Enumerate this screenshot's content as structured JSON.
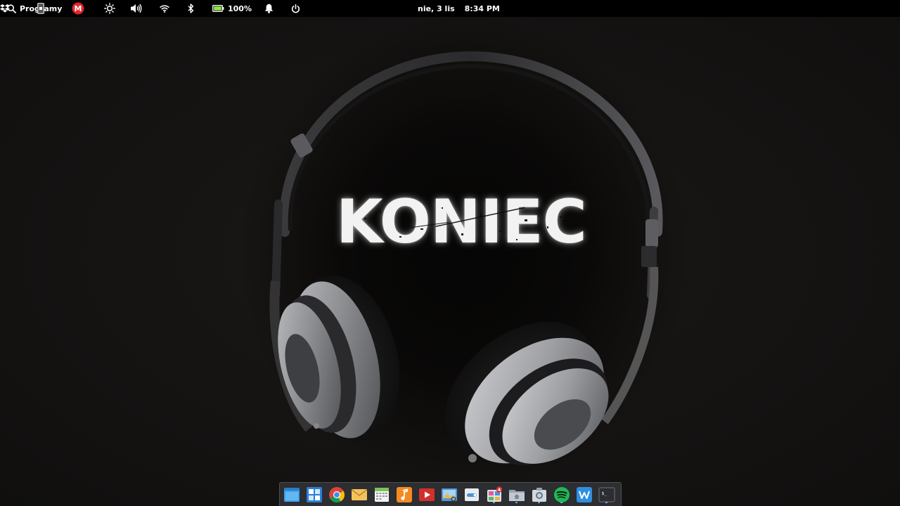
{
  "top_panel": {
    "apps_menu": {
      "label": "Programy",
      "icon": "search-icon"
    },
    "clock": {
      "date": "nie, 3 lis",
      "time": "8:34 PM"
    },
    "indicators": [
      {
        "name": "dropbox-icon"
      },
      {
        "name": "phone-icon"
      },
      {
        "name": "mega-icon",
        "label": "M",
        "color": "#e1242b"
      },
      {
        "name": "brightness-icon"
      },
      {
        "name": "volume-icon"
      },
      {
        "name": "wifi-icon"
      },
      {
        "name": "bluetooth-icon"
      },
      {
        "name": "battery-icon",
        "label": "100%",
        "level": 1.0,
        "color": "#8ee83f"
      },
      {
        "name": "notifications-icon"
      },
      {
        "name": "power-icon"
      }
    ]
  },
  "wallpaper": {
    "title": "KONIEC"
  },
  "dock": {
    "items": [
      {
        "name": "multitasking-view",
        "running": false
      },
      {
        "name": "app-launcher",
        "running": false
      },
      {
        "name": "google-chrome",
        "running": false
      },
      {
        "name": "mail",
        "running": false
      },
      {
        "name": "calendar",
        "running": false
      },
      {
        "name": "music",
        "running": false
      },
      {
        "name": "videos",
        "running": false
      },
      {
        "name": "photos",
        "running": false
      },
      {
        "name": "system-settings",
        "running": false
      },
      {
        "name": "appcenter",
        "badge": "4",
        "running": true
      },
      {
        "name": "files",
        "running": true
      },
      {
        "name": "screenshot",
        "running": true
      },
      {
        "name": "spotify",
        "running": true
      },
      {
        "name": "writer",
        "running": false
      },
      {
        "name": "terminal",
        "running": true,
        "label": "$_"
      }
    ]
  }
}
